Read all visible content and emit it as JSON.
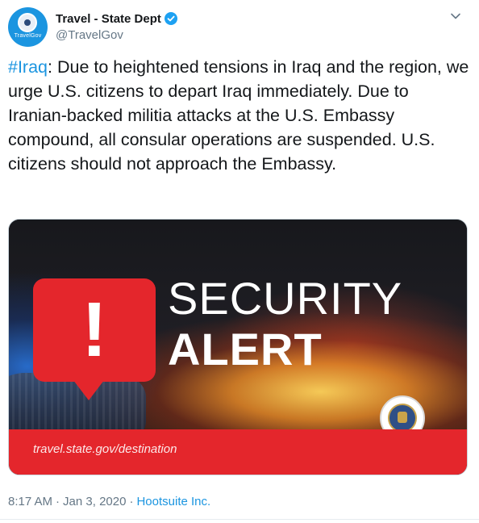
{
  "tweet": {
    "author": {
      "display_name": "Travel - State Dept",
      "handle": "@TravelGov",
      "verified": true,
      "avatar_text": "TravelGov"
    },
    "text": {
      "hashtag": "#Iraq",
      "body": ": Due to heightened tensions in Iraq and the region, we urge U.S. citizens to depart Iraq immediately. Due to Iranian-backed militia attacks at the U.S. Embassy compound, all consular operations are suspended. U.S. citizens should not approach the Embassy."
    },
    "media": {
      "headline_line1": "SECURITY",
      "headline_line2": "ALERT",
      "exclamation": "!",
      "footer_url": "travel.state.gov/destination"
    },
    "meta": {
      "time": "8:17 AM",
      "separator": "·",
      "date": "Jan 3, 2020",
      "source": "Hootsuite Inc."
    }
  },
  "colors": {
    "accent_blue": "#1b95e0",
    "alert_red": "#e4262c",
    "muted_text": "#657786"
  },
  "icons": [
    "verified-badge-icon",
    "chevron-down-icon",
    "state-dept-seal-icon"
  ]
}
